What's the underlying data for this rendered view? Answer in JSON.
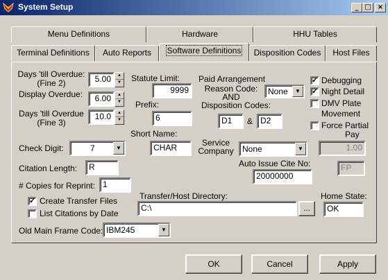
{
  "window": {
    "title": "System Setup",
    "min": "_",
    "max": "□",
    "close": "×"
  },
  "tabs_row1": [
    "Menu Definitions",
    "Hardware",
    "HHU Tables"
  ],
  "tabs_row2": [
    "Terminal Definitions",
    "Auto Reports",
    "Software Definitions",
    "Disposition Codes",
    "Host Files"
  ],
  "form": {
    "days_overdue_fine2_label": "Days 'till Overdue:",
    "days_overdue_fine2_sub": "(Fine 2)",
    "days_overdue_fine2_value": "5.00",
    "display_overdue_label": "Display Overdue:",
    "display_overdue_value": "6.00",
    "days_overdue_fine3_label": "Days 'till Overdue",
    "days_overdue_fine3_sub": "(Fine 3)",
    "days_overdue_fine3_value": "10.0",
    "statute_limit_label": "Statute Limit:",
    "statute_limit_value": "9999",
    "prefix_label": "Prefix:",
    "prefix_value": "6",
    "short_name_label": "Short Name:",
    "short_name_value": "CHAR",
    "paid_arrangement_label": "Paid Arrangement",
    "reason_code_label": "Reason Code:",
    "reason_code_value": "None",
    "and_label": "AND",
    "disposition_codes_label": "Disposition Codes:",
    "disposition_code1": "D1",
    "amp_label": "&",
    "disposition_code2": "D2",
    "debugging_label": "Debugging",
    "night_detail_label": "Night Detail",
    "dmv_plate_label": "DMV Plate",
    "movement_label": "Movement",
    "force_partial_label": "Force Partial",
    "pay_label": "Pay",
    "force_partial_amount": "1.00",
    "check_digit_label": "Check Digit:",
    "check_digit_value": "7",
    "service_company_label": "Service",
    "service_company_label2": "Company",
    "service_company_value": "None",
    "citation_length_label": "Citation Length:",
    "citation_length_value": "R",
    "auto_issue_label": "Auto Issue Cite No:",
    "auto_issue_value": "20000000",
    "fp_value": "FP",
    "copies_label": "# Copies for Reprint:",
    "copies_value": "1",
    "create_transfer_label": "Create Transfer Files",
    "list_citations_label": "List Citations by Date",
    "transfer_dir_label": "Transfer/Host Directory:",
    "transfer_dir_value": "C:\\",
    "browse_label": "...",
    "home_state_label": "Home State:",
    "home_state_value": "OK",
    "old_mainframe_label": "Old Main Frame Code:",
    "old_mainframe_value": "IBM245"
  },
  "checkboxes": {
    "debugging": true,
    "night_detail": true,
    "dmv_plate": false,
    "force_partial": false,
    "create_transfer": true,
    "list_citations": false
  },
  "buttons": {
    "ok": "OK",
    "cancel": "Cancel",
    "apply": "Apply"
  }
}
